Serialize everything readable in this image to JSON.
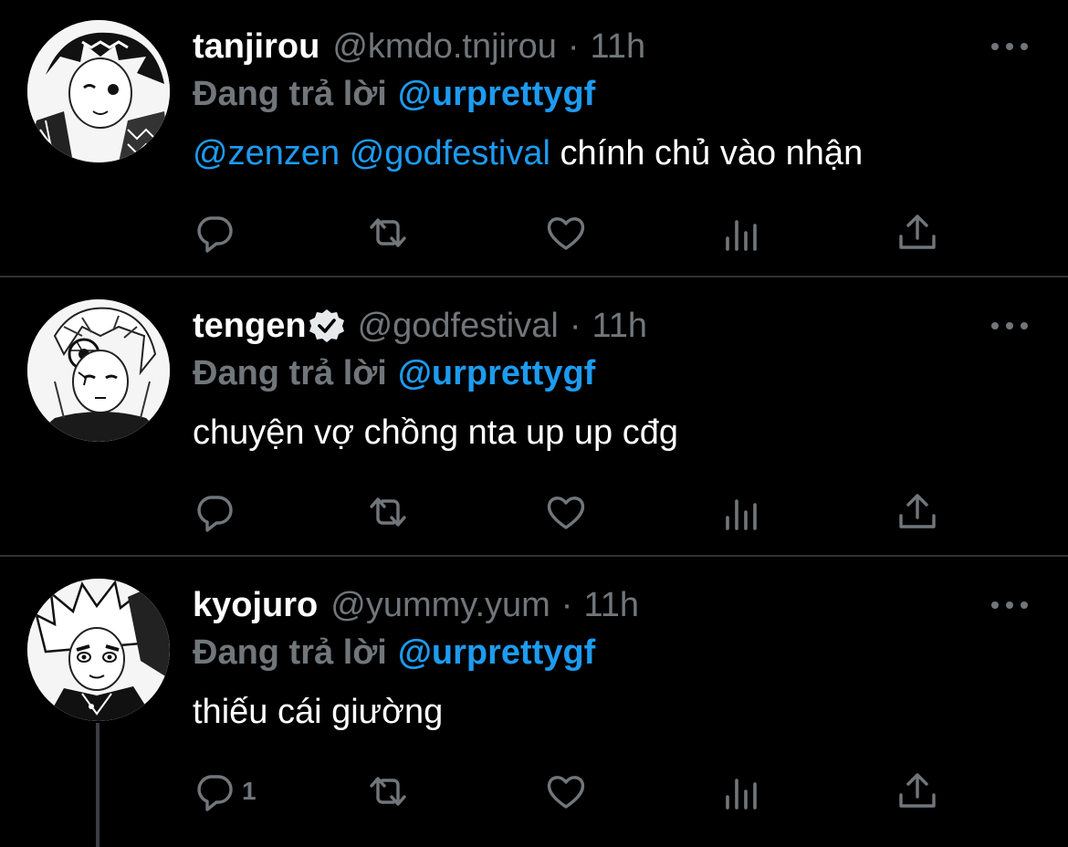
{
  "tweets": [
    {
      "name": "tanjirou",
      "verified": false,
      "handle": "@kmdo.tnjirou",
      "separator": "·",
      "time": "11h",
      "replying_label": "Đang trả lời",
      "replying_to": "@urprettygf",
      "body_mentions": [
        "@zenzen",
        "@godfestival"
      ],
      "body_text": "chính chủ vào nhận",
      "reply_count": ""
    },
    {
      "name": "tengen",
      "verified": true,
      "handle": "@godfestival",
      "separator": "·",
      "time": "11h",
      "replying_label": "Đang trả lời",
      "replying_to": "@urprettygf",
      "body_mentions": [],
      "body_text": "chuyện vợ chồng nta up up cđg",
      "reply_count": ""
    },
    {
      "name": "kyojuro",
      "verified": false,
      "handle": "@yummy.yum",
      "separator": "·",
      "time": "11h",
      "replying_label": "Đang trả lời",
      "replying_to": "@urprettygf",
      "body_mentions": [],
      "body_text": "thiếu cái giường",
      "reply_count": "1"
    }
  ],
  "icons": {
    "reply": "reply-icon",
    "retweet": "retweet-icon",
    "like": "heart-icon",
    "views": "analytics-icon",
    "share": "share-icon",
    "more": "more-icon",
    "verified": "verified-badge-icon"
  },
  "colors": {
    "background": "#000000",
    "text": "#ffffff",
    "muted": "#71767b",
    "accent": "#1d9bf0",
    "divider": "#2f3336"
  }
}
